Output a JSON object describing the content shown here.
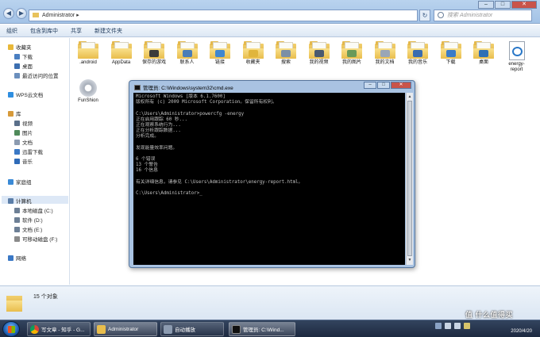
{
  "explorer": {
    "address": "Administrator",
    "search_placeholder": "搜索 Administrator",
    "toolbar": [
      "组织",
      "包含到库中",
      "共享",
      "新建文件夹"
    ],
    "sidebar": [
      {
        "label": "收藏夹",
        "icon": "star-icon",
        "color": "#e8b838",
        "sub": false
      },
      {
        "label": "下载",
        "icon": "download-icon",
        "color": "#4a7fc1",
        "sub": true
      },
      {
        "label": "桌面",
        "icon": "desktop-icon",
        "color": "#3c6fb0",
        "sub": true
      },
      {
        "label": "最近访问的位置",
        "icon": "recent-icon",
        "color": "#6b8fbd",
        "sub": true
      },
      {
        "label": "WPS云文档",
        "icon": "cloud-icon",
        "color": "#2f8ee0",
        "sub": false
      },
      {
        "label": "库",
        "icon": "library-icon",
        "color": "#d79a3a",
        "sub": false
      },
      {
        "label": "视频",
        "icon": "video-icon",
        "color": "#5a6f8a",
        "sub": true
      },
      {
        "label": "图片",
        "icon": "picture-icon",
        "color": "#4f8a5a",
        "sub": true
      },
      {
        "label": "文档",
        "icon": "document-icon",
        "color": "#8c9bb0",
        "sub": true
      },
      {
        "label": "迅雷下载",
        "icon": "thunder-icon",
        "color": "#3a78c5",
        "sub": true
      },
      {
        "label": "音乐",
        "icon": "music-icon",
        "color": "#2f6bb8",
        "sub": true
      },
      {
        "label": "家庭组",
        "icon": "homegroup-icon",
        "color": "#3a8ad6",
        "sub": false
      },
      {
        "label": "计算机",
        "icon": "computer-icon",
        "color": "#5b7ea8",
        "sub": false
      },
      {
        "label": "本地磁盘 (C:)",
        "icon": "drive-icon",
        "color": "#6d7f95",
        "sub": true
      },
      {
        "label": "软件 (D:)",
        "icon": "drive-icon",
        "color": "#6d7f95",
        "sub": true
      },
      {
        "label": "文档 (E:)",
        "icon": "drive-icon",
        "color": "#6d7f95",
        "sub": true
      },
      {
        "label": "可移动磁盘 (F:)",
        "icon": "usb-drive-icon",
        "color": "#8a8a8a",
        "sub": true
      },
      {
        "label": "网络",
        "icon": "network-icon",
        "color": "#3a78c5",
        "sub": false
      }
    ],
    "files": [
      {
        "name": ".android",
        "type": "folder"
      },
      {
        "name": "AppData",
        "type": "folder"
      },
      {
        "name": "保存的游戏",
        "type": "folder",
        "badge": "#3b3b3b"
      },
      {
        "name": "联系人",
        "type": "folder",
        "badge": "#4a7db8"
      },
      {
        "name": "链接",
        "type": "folder",
        "badge": "#3f87d0"
      },
      {
        "name": "收藏夹",
        "type": "folder",
        "badge": "#e0b53c"
      },
      {
        "name": "搜索",
        "type": "folder",
        "badge": "#7c8fa6"
      },
      {
        "name": "我的视频",
        "type": "folder",
        "badge": "#4a5a70"
      },
      {
        "name": "我的图片",
        "type": "folder",
        "badge": "#6a9a5a"
      },
      {
        "name": "我的文档",
        "type": "folder",
        "badge": "#9aa6b6"
      },
      {
        "name": "我的音乐",
        "type": "folder",
        "badge": "#3a6cb0"
      },
      {
        "name": "下载",
        "type": "folder",
        "badge": "#3a7bc8"
      },
      {
        "name": "桌面",
        "type": "folder",
        "badge": "#2f6fb5"
      },
      {
        "name": "energy-report",
        "type": "html"
      },
      {
        "name": "FunShion",
        "type": "app"
      }
    ],
    "status_count": "15 个对象"
  },
  "cmd": {
    "title": "管理员: C:\\Windows\\system32\\cmd.exe",
    "lines": [
      "Microsoft Windows [版本 6.1.7600]",
      "版权所有 (c) 2009 Microsoft Corporation。保留所有权利。",
      "",
      "C:\\Users\\Administrator>powercfg -energy",
      "正在启用跟踪 60 秒...",
      "正在观察系统行为...",
      "正在分析跟踪数据...",
      "分析完成。",
      "",
      "发现能量效率问题。",
      "",
      "6 个错误",
      "13 个警告",
      "16 个信息",
      "",
      "有关详细信息，请参见 C:\\Users\\Administrator\\energy-report.html。",
      "",
      "C:\\Users\\Administrator>_"
    ]
  },
  "taskbar": {
    "buttons": [
      {
        "label": "写文章 - 知乎 - G...",
        "icon_color": "#d44a3a"
      },
      {
        "label": "Administrator",
        "icon_color": "#e8bd4c"
      },
      {
        "label": "自动播放",
        "icon_color": "#8c9bb0"
      },
      {
        "label": "管理员: C:\\Wind...",
        "icon_color": "#111111"
      }
    ],
    "date": "2020/4/20",
    "watermark": "值 什么值得买"
  }
}
